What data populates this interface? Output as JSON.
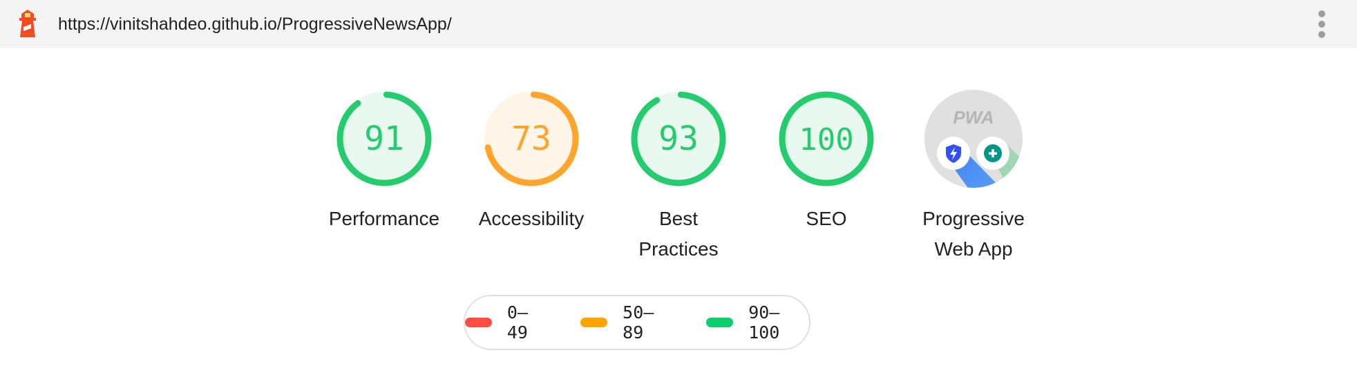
{
  "header": {
    "url": "https://vinitshahdeo.github.io/ProgressiveNewsApp/",
    "logo_icon": "lighthouse-icon",
    "menu_icon": "more-vert-icon"
  },
  "gauges": [
    {
      "id": "performance",
      "score": 91,
      "label_lines": [
        "Performance"
      ],
      "status": "pass"
    },
    {
      "id": "accessibility",
      "score": 73,
      "label_lines": [
        "Accessibility"
      ],
      "status": "average"
    },
    {
      "id": "best-practices",
      "score": 93,
      "label_lines": [
        "Best",
        "Practices"
      ],
      "status": "pass"
    },
    {
      "id": "seo",
      "score": 100,
      "label_lines": [
        "SEO"
      ],
      "status": "pass"
    }
  ],
  "pwa": {
    "label_lines": [
      "Progressive",
      "Web App"
    ],
    "badge_text": "PWA",
    "badges": [
      "fast-reliable-shield-icon",
      "installable-plus-icon"
    ]
  },
  "legend": [
    {
      "range": "0–49",
      "color": "#ff4e42"
    },
    {
      "range": "50–89",
      "color": "#ffa400"
    },
    {
      "range": "90–100",
      "color": "#0cce6b"
    }
  ],
  "colors": {
    "pass": "#0cce6b",
    "pass_text": "#0cce6b",
    "pass_bg": "#e7f8ee",
    "average": "#ffa400",
    "average_text": "#ffa400",
    "average_bg": "#fff5e8",
    "fail": "#ff4e42"
  }
}
